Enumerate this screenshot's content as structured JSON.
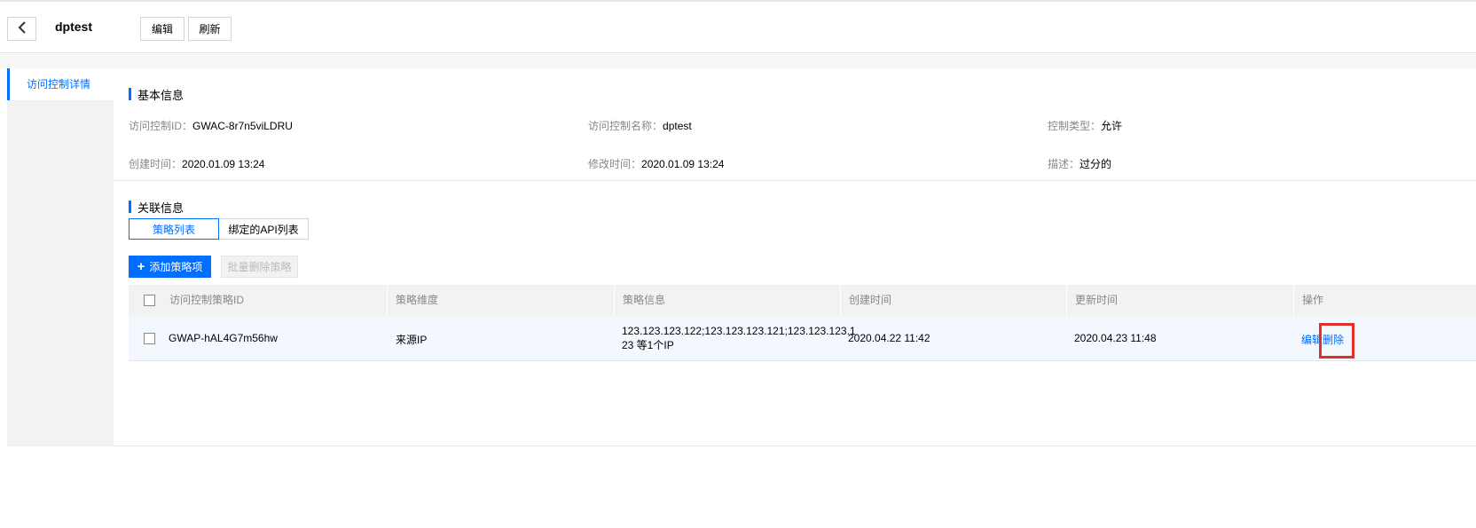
{
  "header": {
    "title": "dptest",
    "edit_label": "编辑",
    "refresh_label": "刷新"
  },
  "sidebar": {
    "items": [
      {
        "label": "访问控制详情"
      }
    ]
  },
  "basic_info": {
    "title": "基本信息",
    "fields": [
      {
        "label": "访问控制ID：",
        "value": "GWAC-8r7n5viLDRU"
      },
      {
        "label": "访问控制名称：",
        "value": "dptest"
      },
      {
        "label": "控制类型：",
        "value": "允许"
      },
      {
        "label": "创建时间：",
        "value": "2020.01.09 13:24"
      },
      {
        "label": "修改时间：",
        "value": "2020.01.09 13:24"
      },
      {
        "label": "描述：",
        "value": "过分的"
      }
    ]
  },
  "related_info": {
    "title": "关联信息",
    "tabs": [
      {
        "label": "策略列表"
      },
      {
        "label": "绑定的API列表"
      }
    ],
    "add_button": "添加策略项",
    "batch_delete_button": "批量删除策略"
  },
  "table": {
    "columns": [
      "访问控制策略ID",
      "策略维度",
      "策略信息",
      "创建时间",
      "更新时间",
      "操作"
    ],
    "rows": [
      {
        "id": "GWAP-hAL4G7m56hw",
        "dimension": "来源IP",
        "info_line1": "123.123.123.122;123.123.123.121;123.123.123.1",
        "info_line2": "23 等1个IP",
        "created": "2020.04.22 11:42",
        "updated": "2020.04.23 11:48",
        "action_edit": "编辑",
        "action_delete": "删除"
      }
    ]
  },
  "colors": {
    "accent": "#006eff",
    "highlight": "#e0302a"
  }
}
